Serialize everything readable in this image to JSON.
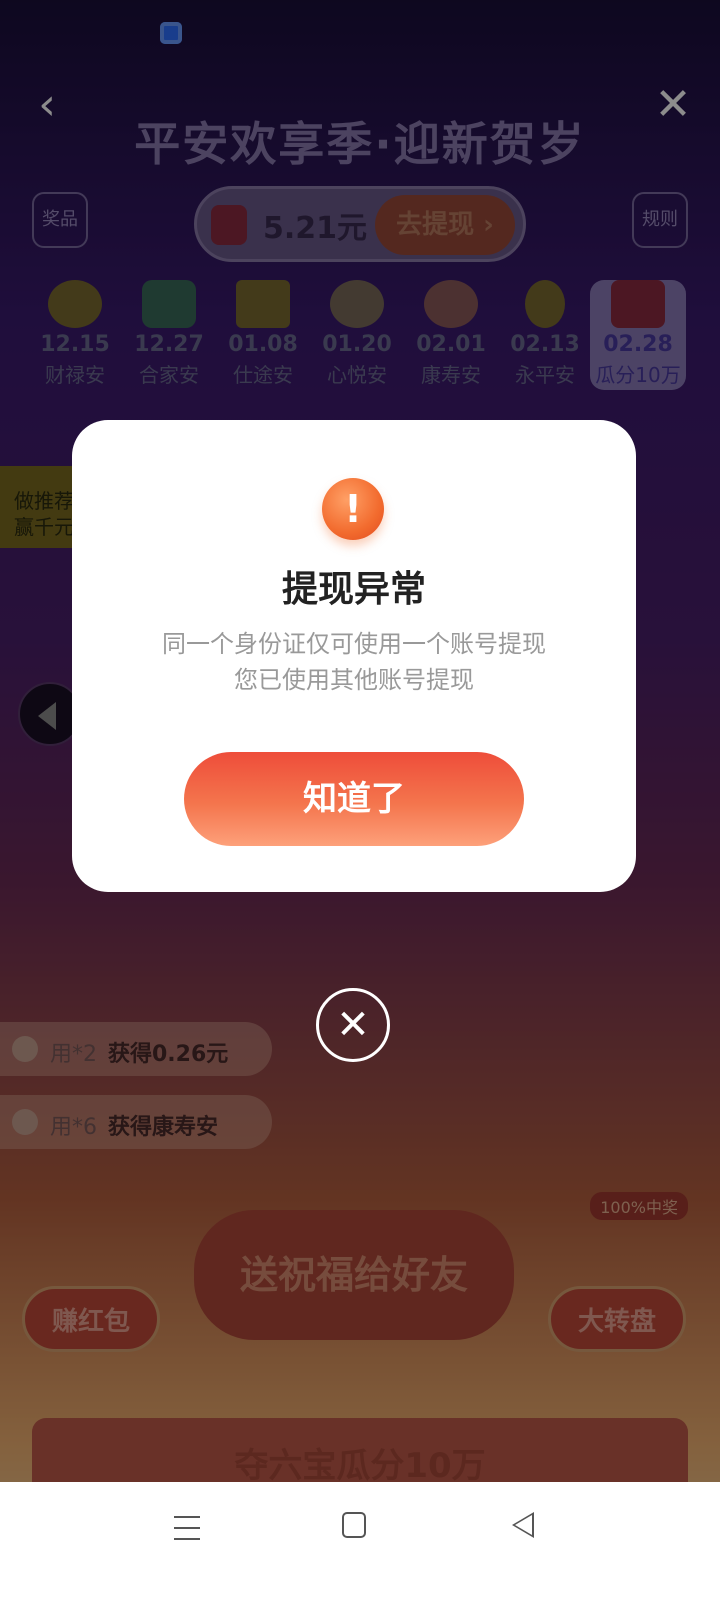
{
  "header": {
    "title": "平安欢享季·迎新贺岁",
    "back_glyph": "‹",
    "close_glyph": "✕",
    "prize_label": "奖品",
    "rules_label": "规则"
  },
  "balance": {
    "amount": "5.21元",
    "withdraw_label": "去提现 ›"
  },
  "timeline": [
    {
      "date": "12.15",
      "name": "财禄安"
    },
    {
      "date": "12.27",
      "name": "合家安"
    },
    {
      "date": "01.08",
      "name": "仕途安"
    },
    {
      "date": "01.20",
      "name": "心悦安"
    },
    {
      "date": "02.01",
      "name": "康寿安"
    },
    {
      "date": "02.13",
      "name": "永平安"
    },
    {
      "date": "02.28",
      "name": "瓜分10万"
    }
  ],
  "left_promo": {
    "line1": "做推荐",
    "line2": "赢千元"
  },
  "winners": [
    {
      "who": "用*2",
      "what": "获得0.26元"
    },
    {
      "who": "用*6",
      "what": "获得康寿安"
    }
  ],
  "game": {
    "earn_label": "赚红包",
    "send_label": "送祝福给好友",
    "wheel_label": "大转盘",
    "badge": "100%中奖",
    "banner": "夺六宝瓜分10万"
  },
  "dialog": {
    "icon_glyph": "!",
    "title": "提现异常",
    "message_line1": "同一个身份证仅可使用一个账号提现",
    "message_line2": "您已使用其他账号提现",
    "ok_label": "知道了",
    "close_glyph": "✕"
  },
  "colors": {
    "accent": "#f26b2e",
    "button_top": "#ee4d3a",
    "button_bottom": "#fda07a"
  }
}
